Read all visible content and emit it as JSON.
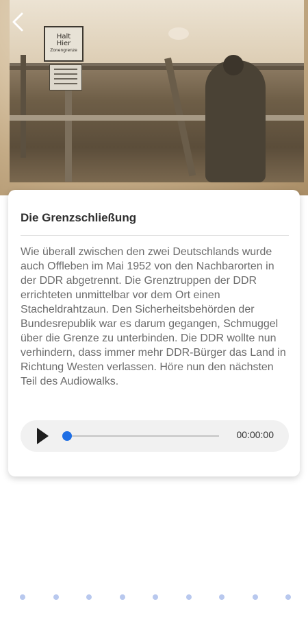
{
  "photo": {
    "sign_main_line1": "Halt",
    "sign_main_line2": "Hier",
    "sign_main_line3": "Zonengrenze"
  },
  "card": {
    "title": "Die Grenzschließung",
    "body": "Wie überall zwischen den zwei Deutschlands wurde auch Offleben im Mai 1952 von den Nachbarorten in der DDR abgetrennt. Die Grenztruppen der DDR errichteten unmittelbar vor dem Ort einen Stacheldrahtzaun. Den Sicherheitsbehörden der Bundesrepublik war es darum gegangen, Schmuggel über die Grenze zu unterbinden. Die DDR wollte nun verhindern, dass immer mehr DDR-Bürger das Land in Richtung Westen verlassen. Höre nun den nächsten Teil des Audiowalks."
  },
  "player": {
    "time": "00:00:00",
    "progress": 0
  },
  "pager": {
    "count": 9
  },
  "icons": {
    "back": "chevron-left-icon",
    "play": "play-icon"
  }
}
